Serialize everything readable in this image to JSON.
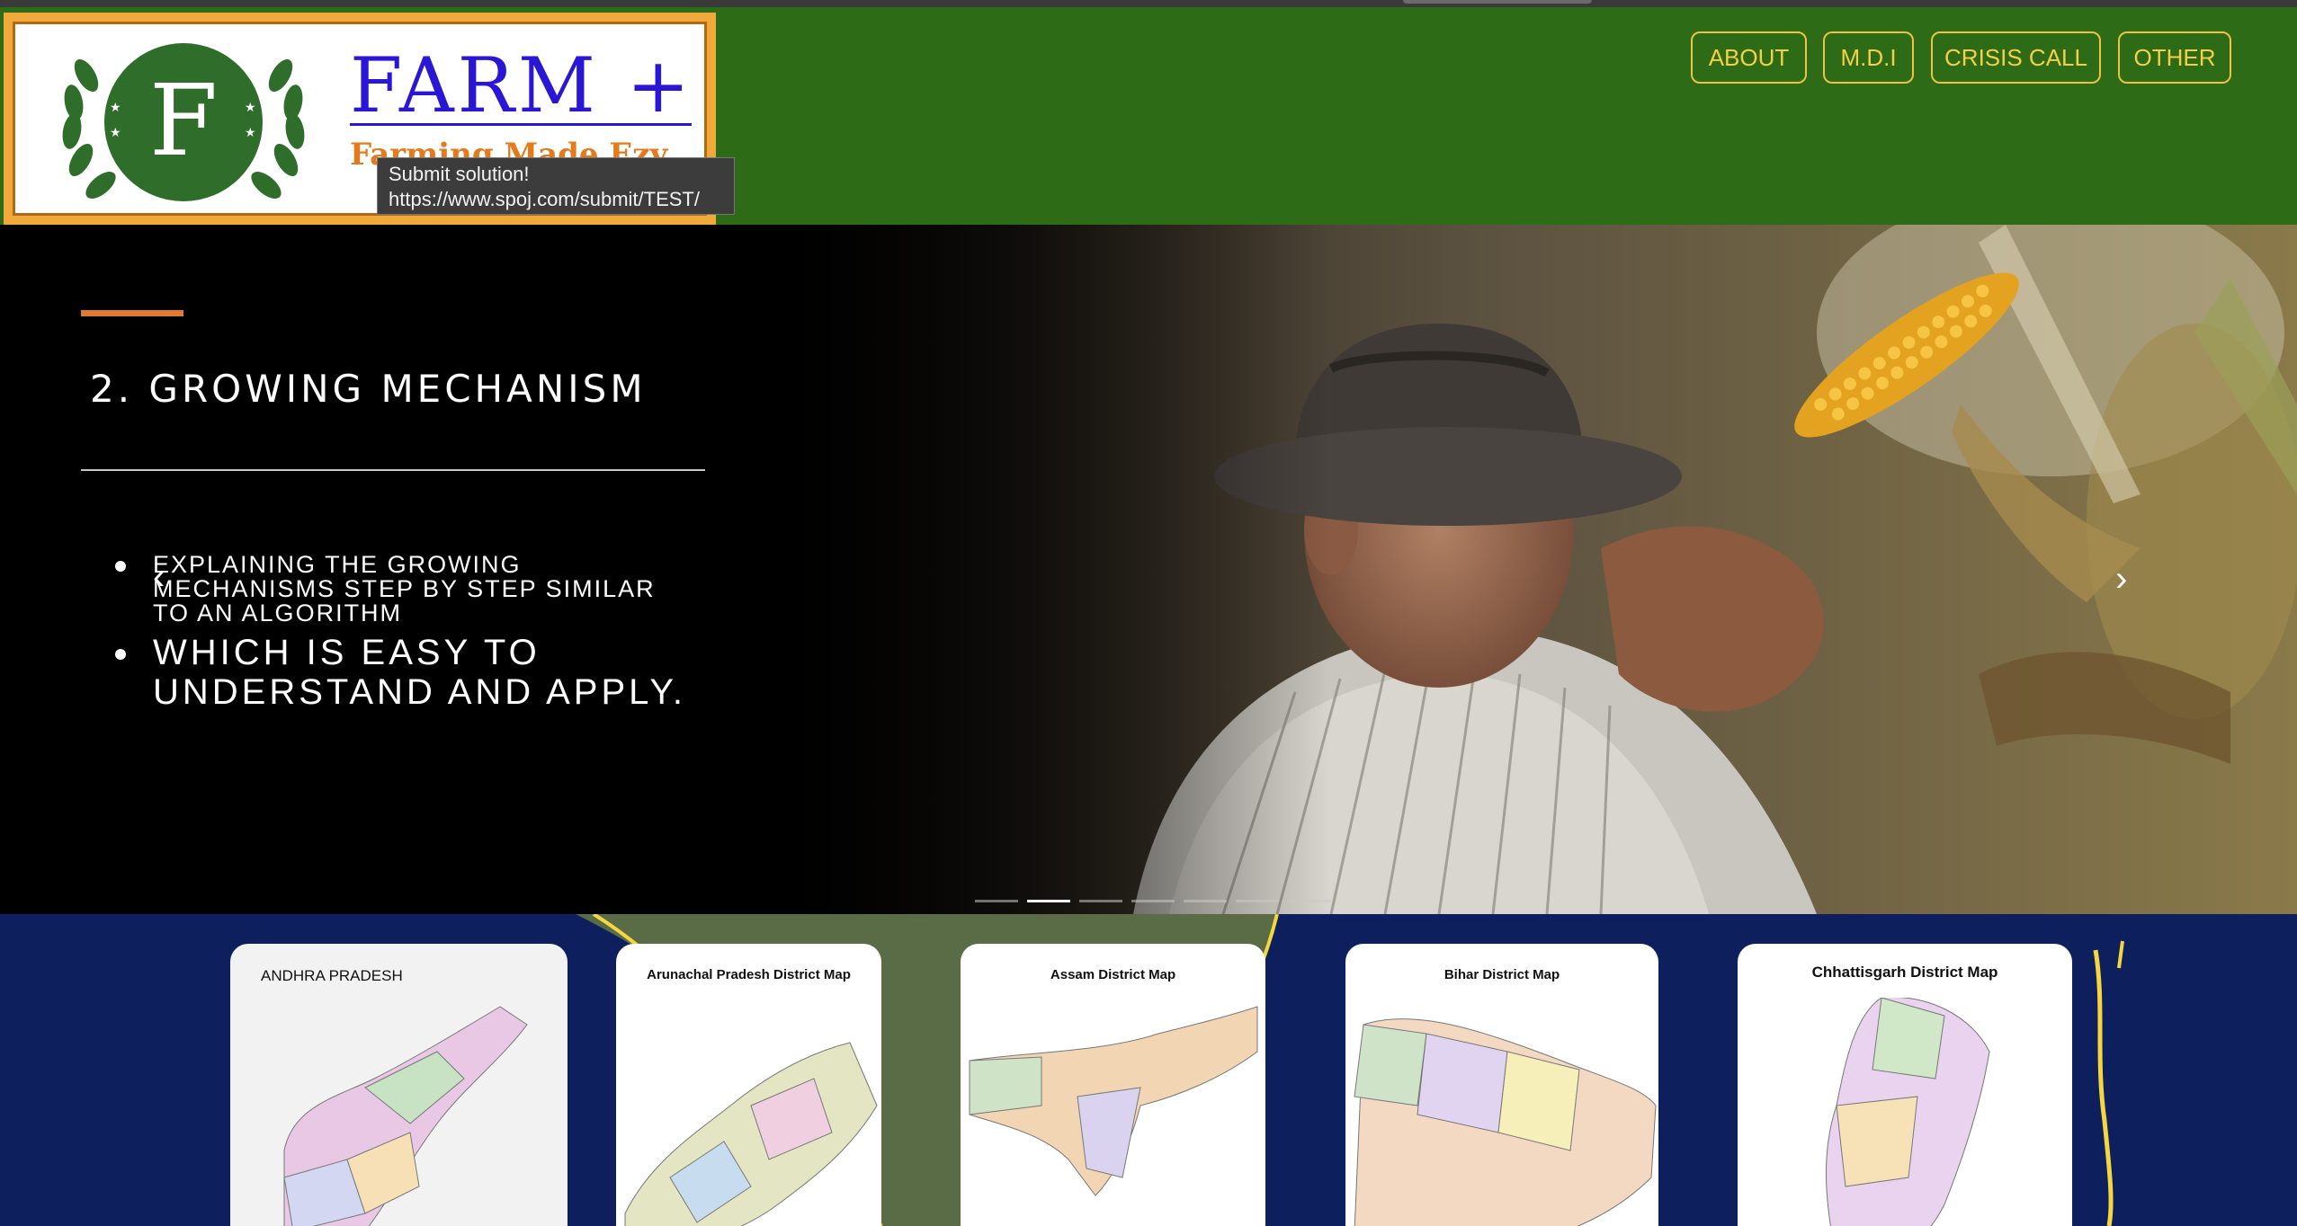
{
  "header": {
    "logo": {
      "letter": "F",
      "name": "FARM +",
      "tagline": "Farming Made Ezy"
    },
    "nav": [
      {
        "label": "ABOUT"
      },
      {
        "label": "M.D.I"
      },
      {
        "label": "CRISIS CALL"
      },
      {
        "label": "OTHER"
      }
    ],
    "tooltip": {
      "title": "Submit solution!",
      "url": "https://www.spoj.com/submit/TEST/"
    }
  },
  "slide": {
    "title": "2. GROWING MECHANISM",
    "bullets": [
      "EXPLAINING THE GROWING MECHANISMS STEP BY STEP SIMILAR TO AN ALGORITHM",
      "WHICH IS EASY TO UNDERSTAND AND APPLY."
    ],
    "indicator_count": 7,
    "active_index": 1,
    "prev_glyph": "‹",
    "next_glyph": "›"
  },
  "maps": [
    {
      "title": "ANDHRA PRADESH"
    },
    {
      "title": "Arunachal Pradesh District Map"
    },
    {
      "title": "Assam District Map"
    },
    {
      "title": "Bihar District Map"
    },
    {
      "title": "Chhattisgarh District Map"
    }
  ],
  "colors": {
    "header_bg": "#2e6b16",
    "nav_border": "#f1c23e",
    "accent": "#e07a34",
    "logo_blue": "#2a17d6",
    "logo_orange": "#e6791a"
  }
}
